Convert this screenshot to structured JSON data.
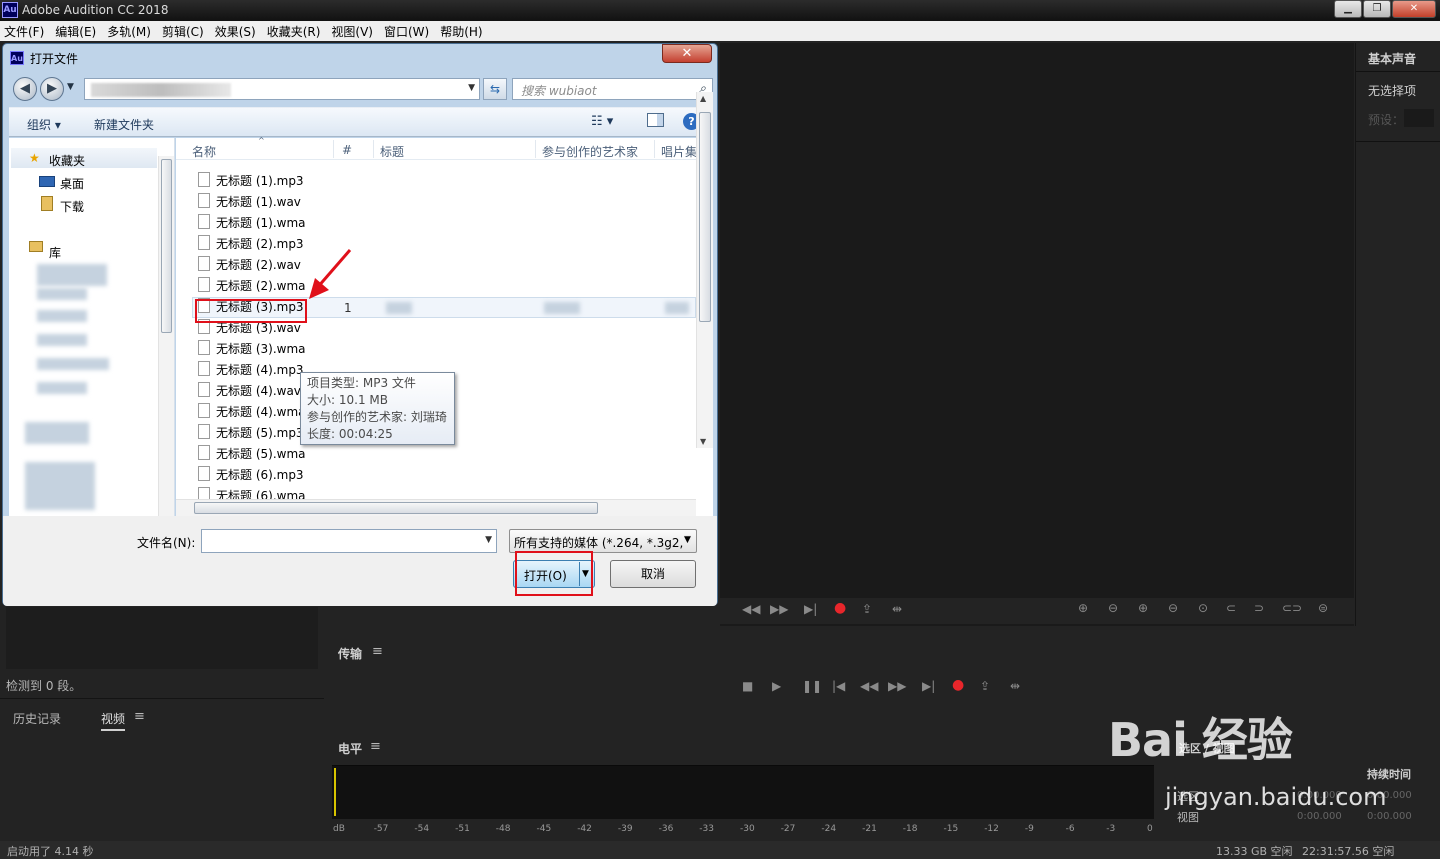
{
  "app": {
    "logo": "Au",
    "title": "Adobe Audition CC 2018"
  },
  "window_controls": {
    "minimize": "▁",
    "maximize": "❐",
    "close": "✕"
  },
  "menu": [
    "文件(F)",
    "编辑(E)",
    "多轨(M)",
    "剪辑(C)",
    "效果(S)",
    "收藏夹(R)",
    "视图(V)",
    "窗口(W)",
    "帮助(H)"
  ],
  "right_panel": {
    "title": "基本声音",
    "no_selection": "无选择项",
    "preset_label": "预设："
  },
  "left_bottom": {
    "detected": "检测到 0 段。",
    "tabs": [
      "历史记录",
      "视频"
    ]
  },
  "transport": {
    "title": "传输"
  },
  "levels": {
    "title": "电平",
    "ticks": [
      "dB",
      "-57",
      "-54",
      "-51",
      "-48",
      "-45",
      "-42",
      "-39",
      "-36",
      "-33",
      "-30",
      "-27",
      "-24",
      "-21",
      "-18",
      "-15",
      "-12",
      "-9",
      "-6",
      "-3",
      "0"
    ]
  },
  "selection_panel": {
    "title": "选区 / 视图",
    "duration": "持续时间",
    "rows": [
      "选区",
      "视图"
    ],
    "values": [
      "0:00.000",
      "0:00.000"
    ],
    "starts": [
      "0:00.000",
      "0:00.000"
    ]
  },
  "status": {
    "startup": "启动用了 4.14 秒",
    "disk": "13.33 GB 空闲",
    "time": "22:31:57.56 空闲"
  },
  "dialog": {
    "logo": "Au",
    "title": "打开文件",
    "close": "✕",
    "search_placeholder": "搜索 wubiaot",
    "toolbar": {
      "organize": "组织 ▾",
      "new_folder": "新建文件夹"
    },
    "nav": {
      "favorites": "收藏夹",
      "desktop": "桌面",
      "downloads": "下载",
      "libraries": "库"
    },
    "columns": [
      "名称",
      "#",
      "标题",
      "参与创作的艺术家",
      "唱片集"
    ],
    "files": [
      "无标题 (1).mp3",
      "无标题 (1).wav",
      "无标题 (1).wma",
      "无标题 (2).mp3",
      "无标题 (2).wav",
      "无标题 (2).wma",
      "无标题 (3).mp3",
      "无标题 (3).wav",
      "无标题 (3).wma",
      "无标题 (4).mp3",
      "无标题 (4).wav",
      "无标题 (4).wma",
      "无标题 (5).mp3",
      "无标题 (5).wma",
      "无标题 (6).mp3",
      "无标题 (6).wma"
    ],
    "highlighted_track_no": "1",
    "tooltip": [
      "项目类型: MP3 文件",
      "大小: 10.1 MB",
      "参与创作的艺术家: 刘瑞琦",
      "长度: 00:04:25"
    ],
    "filename_label": "文件名(N):",
    "filename_value": "",
    "filetype": "所有支持的媒体 (*.264, *.3g2,",
    "open": "打开(O)",
    "cancel": "取消"
  },
  "watermark": {
    "brand": "Bai 经验",
    "url": "jingyan.baidu.com"
  },
  "colors": {
    "annotation_red": "#e0101a",
    "record_red": "#e8262b",
    "app_bg": "#232323"
  }
}
